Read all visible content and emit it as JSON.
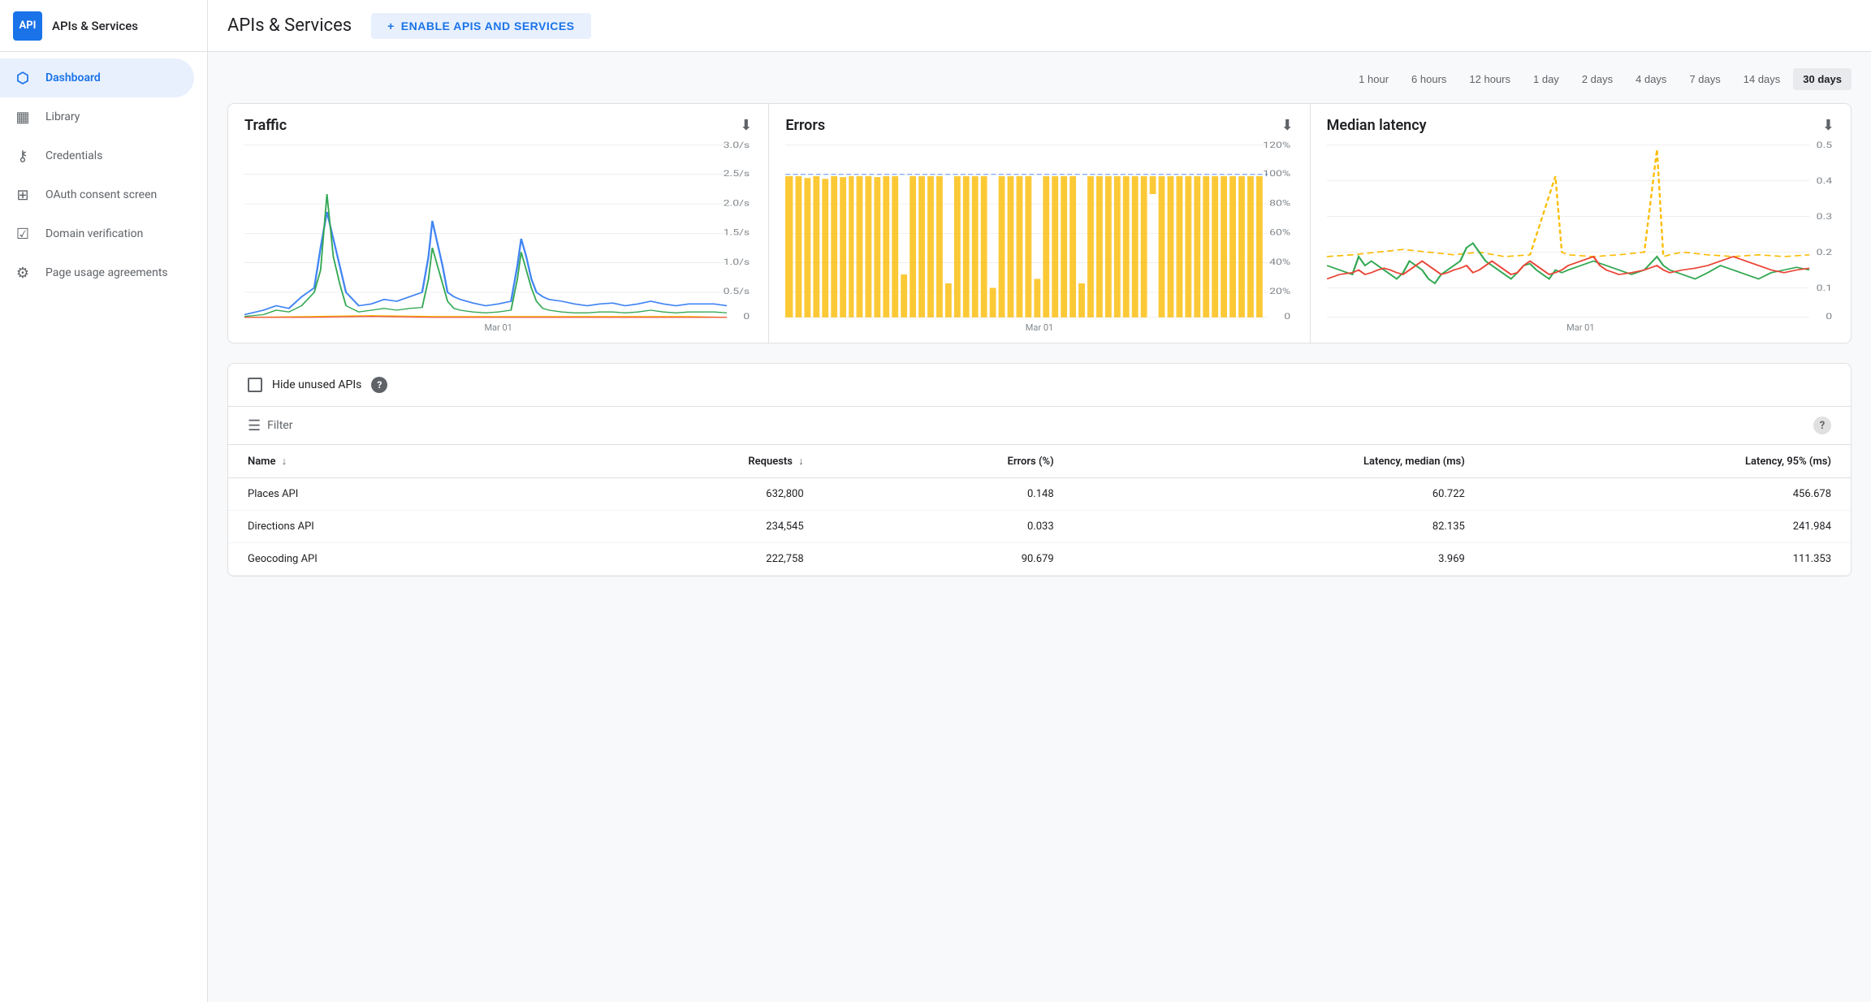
{
  "sidebar": {
    "logo_text": "API",
    "header_title": "APIs & Services",
    "nav_items": [
      {
        "id": "dashboard",
        "label": "Dashboard",
        "icon": "⬡",
        "active": true
      },
      {
        "id": "library",
        "label": "Library",
        "icon": "▦",
        "active": false
      },
      {
        "id": "credentials",
        "label": "Credentials",
        "icon": "⚷",
        "active": false
      },
      {
        "id": "oauth",
        "label": "OAuth consent screen",
        "icon": "⊞",
        "active": false
      },
      {
        "id": "domain",
        "label": "Domain verification",
        "icon": "☑",
        "active": false
      },
      {
        "id": "page-usage",
        "label": "Page usage agreements",
        "icon": "⚙",
        "active": false
      }
    ]
  },
  "header": {
    "title": "APIs & Services",
    "enable_btn_label": "ENABLE APIS AND SERVICES",
    "enable_btn_icon": "+"
  },
  "time_range": {
    "options": [
      "1 hour",
      "6 hours",
      "12 hours",
      "1 day",
      "2 days",
      "4 days",
      "7 days",
      "14 days",
      "30 days"
    ],
    "active": "30 days"
  },
  "charts": [
    {
      "id": "traffic",
      "title": "Traffic",
      "date_label": "Mar 01",
      "y_labels": [
        "3.0/s",
        "2.5/s",
        "2.0/s",
        "1.5/s",
        "1.0/s",
        "0.5/s",
        "0"
      ]
    },
    {
      "id": "errors",
      "title": "Errors",
      "date_label": "Mar 01",
      "y_labels": [
        "120%",
        "100%",
        "80%",
        "60%",
        "40%",
        "20%",
        "0"
      ]
    },
    {
      "id": "latency",
      "title": "Median latency",
      "date_label": "Mar 01",
      "y_labels": [
        "0.5",
        "0.4",
        "0.3",
        "0.2",
        "0.1",
        "0"
      ]
    }
  ],
  "filter": {
    "hide_unused_label": "Hide unused APIs",
    "filter_placeholder": "Filter"
  },
  "table": {
    "columns": [
      {
        "id": "name",
        "label": "Name",
        "sortable": true
      },
      {
        "id": "requests",
        "label": "Requests",
        "sortable": true
      },
      {
        "id": "errors",
        "label": "Errors (%)",
        "sortable": false
      },
      {
        "id": "latency_median",
        "label": "Latency, median (ms)",
        "sortable": false
      },
      {
        "id": "latency_95",
        "label": "Latency, 95% (ms)",
        "sortable": false
      }
    ],
    "rows": [
      {
        "name": "Places API",
        "requests": "632,800",
        "errors": "0.148",
        "latency_median": "60.722",
        "latency_95": "456.678"
      },
      {
        "name": "Directions API",
        "requests": "234,545",
        "errors": "0.033",
        "latency_median": "82.135",
        "latency_95": "241.984"
      },
      {
        "name": "Geocoding API",
        "requests": "222,758",
        "errors": "90.679",
        "latency_median": "3.969",
        "latency_95": "111.353"
      }
    ]
  }
}
